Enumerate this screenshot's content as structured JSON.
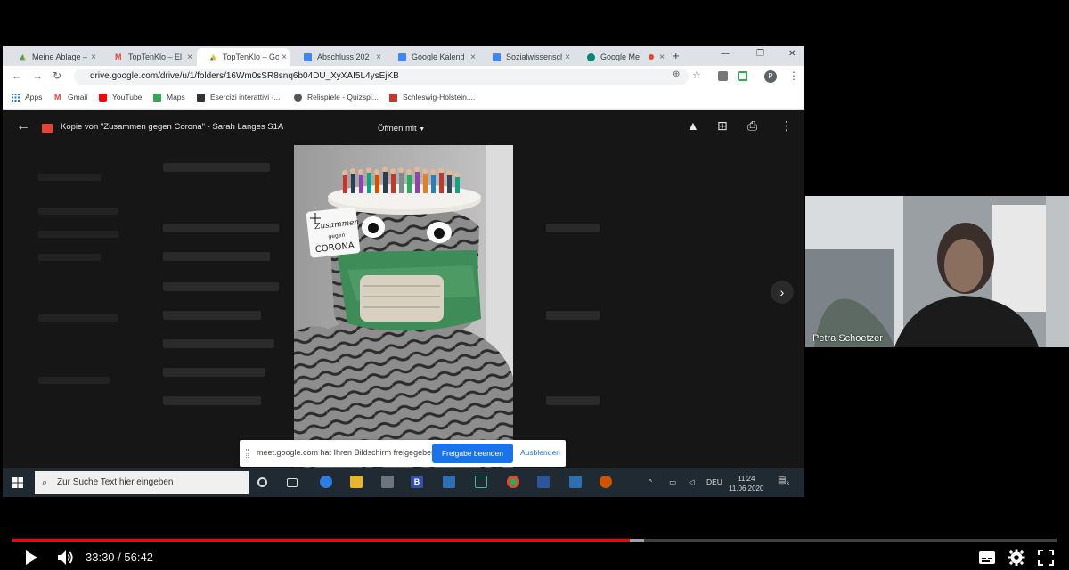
{
  "browser": {
    "tabs": [
      {
        "label": "Meine Ablage –",
        "icon": "google-drive-icon",
        "color": "#34a853",
        "active": false
      },
      {
        "label": "TopTenKlo – El",
        "icon": "gmail-icon",
        "color": "#ea4335",
        "active": false
      },
      {
        "label": "TopTenKlo – Go",
        "icon": "google-drive-icon",
        "color": "#fbbc04",
        "active": true
      },
      {
        "label": "Abschluss 202",
        "icon": "google-docs-icon",
        "color": "#4285f4",
        "active": false
      },
      {
        "label": "Google Kalend",
        "icon": "calendar-icon",
        "color": "#4285f4",
        "active": false
      },
      {
        "label": "Sozialwissensch",
        "icon": "calendar-icon",
        "color": "#4285f4",
        "active": false
      },
      {
        "label": "Google Me",
        "icon": "meet-icon",
        "color": "#00897b",
        "active": false
      }
    ],
    "url": "drive.google.com/drive/u/1/folders/16Wm0sSR8snq6b04DU_XyXAI5L4ysEjKB",
    "profile_letter": "P",
    "bookmarks": [
      {
        "label": "Apps",
        "icon": "apps-grid-icon"
      },
      {
        "label": "Gmail",
        "icon": "gmail-icon"
      },
      {
        "label": "YouTube",
        "icon": "youtube-icon"
      },
      {
        "label": "Maps",
        "icon": "maps-icon"
      },
      {
        "label": "Esercizi interattivi -...",
        "icon": "bookmark-icon"
      },
      {
        "label": "Relispiele - Quizspi...",
        "icon": "bookmark-icon"
      },
      {
        "label": "Schleswig-Holstein....",
        "icon": "bookmark-icon"
      }
    ]
  },
  "viewer": {
    "title": "Kopie von \"Zusammen gegen Corona\" - Sarah Langes S1A",
    "open_with": "Öffnen mit",
    "photo_sign_top": "Zusammen",
    "photo_sign_mid": "gegen",
    "photo_sign_bottom": "CORONA"
  },
  "share_bar": {
    "message": "meet.google.com hat Ihren Bildschirm freigegeben.",
    "stop_label": "Freigabe beenden",
    "hide_label": "Ausblenden"
  },
  "taskbar": {
    "search_placeholder": "Zur Suche Text hier eingeben",
    "lang": "DEU",
    "time": "11:24",
    "date": "11.06.2020",
    "notif_count": "3"
  },
  "webcam": {
    "participant_name": "Petra Schoetzer"
  },
  "player": {
    "current_time": "33:30",
    "duration": "56:42",
    "time_separator": " / ",
    "played_fraction": 0.591,
    "buffered_fraction": 0.605
  }
}
